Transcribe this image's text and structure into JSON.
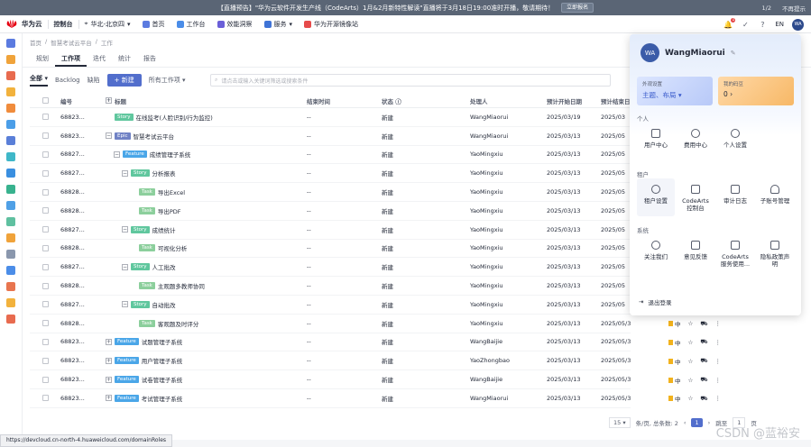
{
  "banner": {
    "text": "【直播预告】\"华为云软件开发生产线（CodeArts）1月&2月新特性解读\"直播将于3月18日19:00准时开播，敬请期待！",
    "button": "立即报名",
    "page": "1/2",
    "close": "不再提示"
  },
  "topnav": {
    "brand": "华为云",
    "console": "控制台",
    "region": "华北-北京四",
    "items": [
      "首页",
      "工作台",
      "效能洞察",
      "服务",
      "华为开源镜像站"
    ],
    "lang": "EN",
    "avatar": "WA",
    "notif_count": "1"
  },
  "breadcrumb": [
    "首页",
    "智慧考试云平台",
    "工作"
  ],
  "tabs": [
    "规划",
    "工作项",
    "迭代",
    "统计",
    "报告"
  ],
  "toolbar": {
    "filter_all": "全部",
    "backlog": "Backlog",
    "defect": "缺陷",
    "new_btn": "+ 新建",
    "all_items": "所有工作项",
    "search_placeholder": "请点击或输入关键词筛选或搜索条件"
  },
  "table": {
    "headers": [
      "编号",
      "标题",
      "结束时间",
      "状态",
      "处理人",
      "预计开始日期",
      "预计结束日"
    ],
    "rows": [
      {
        "id": "68823...",
        "type": "Story",
        "title": "在线监考(人脸识别/行为监控)",
        "indent": 0,
        "expand": "",
        "end": "--",
        "status": "新建",
        "user": "WangMiaorui",
        "start": "2025/03/19",
        "due": "2025/03"
      },
      {
        "id": "68823...",
        "type": "Epic",
        "title": "智慧考试云平台",
        "indent": 0,
        "expand": "−",
        "end": "--",
        "status": "新建",
        "user": "WangMiaorui",
        "start": "2025/03/13",
        "due": "2025/05"
      },
      {
        "id": "68827...",
        "type": "Feature",
        "title": "成绩管理子系统",
        "indent": 1,
        "expand": "−",
        "end": "--",
        "status": "新建",
        "user": "YaoMingxiu",
        "start": "2025/03/13",
        "due": "2025/05"
      },
      {
        "id": "68827...",
        "type": "Story",
        "title": "分析报表",
        "indent": 2,
        "expand": "−",
        "end": "--",
        "status": "新建",
        "user": "YaoMingxiu",
        "start": "2025/03/13",
        "due": "2025/05"
      },
      {
        "id": "68828...",
        "type": "Task",
        "title": "导出Excel",
        "indent": 3,
        "expand": "",
        "end": "--",
        "status": "新建",
        "user": "YaoMingxiu",
        "start": "2025/03/13",
        "due": "2025/05"
      },
      {
        "id": "68828...",
        "type": "Task",
        "title": "导出PDF",
        "indent": 3,
        "expand": "",
        "end": "--",
        "status": "新建",
        "user": "YaoMingxiu",
        "start": "2025/03/13",
        "due": "2025/05"
      },
      {
        "id": "68827...",
        "type": "Story",
        "title": "成绩统计",
        "indent": 2,
        "expand": "−",
        "end": "--",
        "status": "新建",
        "user": "YaoMingxiu",
        "start": "2025/03/13",
        "due": "2025/05"
      },
      {
        "id": "68828...",
        "type": "Task",
        "title": "可视化分析",
        "indent": 3,
        "expand": "",
        "end": "--",
        "status": "新建",
        "user": "YaoMingxiu",
        "start": "2025/03/13",
        "due": "2025/05"
      },
      {
        "id": "68827...",
        "type": "Story",
        "title": "人工批改",
        "indent": 2,
        "expand": "−",
        "end": "--",
        "status": "新建",
        "user": "YaoMingxiu",
        "start": "2025/03/13",
        "due": "2025/05"
      },
      {
        "id": "68828...",
        "type": "Task",
        "title": "主观题多教师协同",
        "indent": 3,
        "expand": "",
        "end": "--",
        "status": "新建",
        "user": "YaoMingxiu",
        "start": "2025/03/13",
        "due": "2025/05"
      },
      {
        "id": "68827...",
        "type": "Story",
        "title": "自动批改",
        "indent": 2,
        "expand": "−",
        "end": "--",
        "status": "新建",
        "user": "YaoMingxiu",
        "start": "2025/03/13",
        "due": "2025/05"
      },
      {
        "id": "68828...",
        "type": "Task",
        "title": "客观题及时评分",
        "indent": 3,
        "expand": "",
        "end": "--",
        "status": "新建",
        "user": "YaoMingxiu",
        "start": "2025/03/13",
        "due": "2025/05/30"
      },
      {
        "id": "68823...",
        "type": "Feature",
        "title": "试题管理子系统",
        "indent": 0,
        "expand": "+",
        "end": "--",
        "status": "新建",
        "user": "WangBaijie",
        "start": "2025/03/13",
        "due": "2025/05/30"
      },
      {
        "id": "68823...",
        "type": "Feature",
        "title": "用户管理子系统",
        "indent": 0,
        "expand": "+",
        "end": "--",
        "status": "新建",
        "user": "YaoZhongbao",
        "start": "2025/03/13",
        "due": "2025/05/30"
      },
      {
        "id": "68823...",
        "type": "Feature",
        "title": "试卷管理子系统",
        "indent": 0,
        "expand": "+",
        "end": "--",
        "status": "新建",
        "user": "WangBaijie",
        "start": "2025/03/13",
        "due": "2025/05/30"
      },
      {
        "id": "68823...",
        "type": "Feature",
        "title": "考试管理子系统",
        "indent": 0,
        "expand": "+",
        "end": "--",
        "status": "新建",
        "user": "WangMiaorui",
        "start": "2025/03/13",
        "due": "2025/05/30"
      }
    ],
    "priority": "中"
  },
  "footer": {
    "page_size": "15",
    "summary": "条/页, 总条数: 2",
    "jump_label": "跳至",
    "jump_value": "1",
    "jump_unit": "页",
    "page": "1"
  },
  "dropdown": {
    "name": "WangMiaorui",
    "avatar": "WA",
    "card1": {
      "title": "外观设置",
      "value": "主题、布局"
    },
    "card2": {
      "title": "我的码豆",
      "value": "0"
    },
    "sec_personal": "个人",
    "personal": [
      "用户中心",
      "费用中心",
      "个人设置"
    ],
    "sec_tenant": "租户",
    "tenant": [
      "租户设置",
      "CodeArts\n控制台",
      "审计日志",
      "子账号管理"
    ],
    "sec_system": "系统",
    "system": [
      "关注我们",
      "意见反馈",
      "CodeArts\n服务使用...",
      "隐私政策声\n明"
    ],
    "logout": "退出登录"
  },
  "statusbar": "https://devcloud.cn-north-4.huaweicloud.com/domainRoles",
  "watermark": "CSDN @蓝裕安"
}
